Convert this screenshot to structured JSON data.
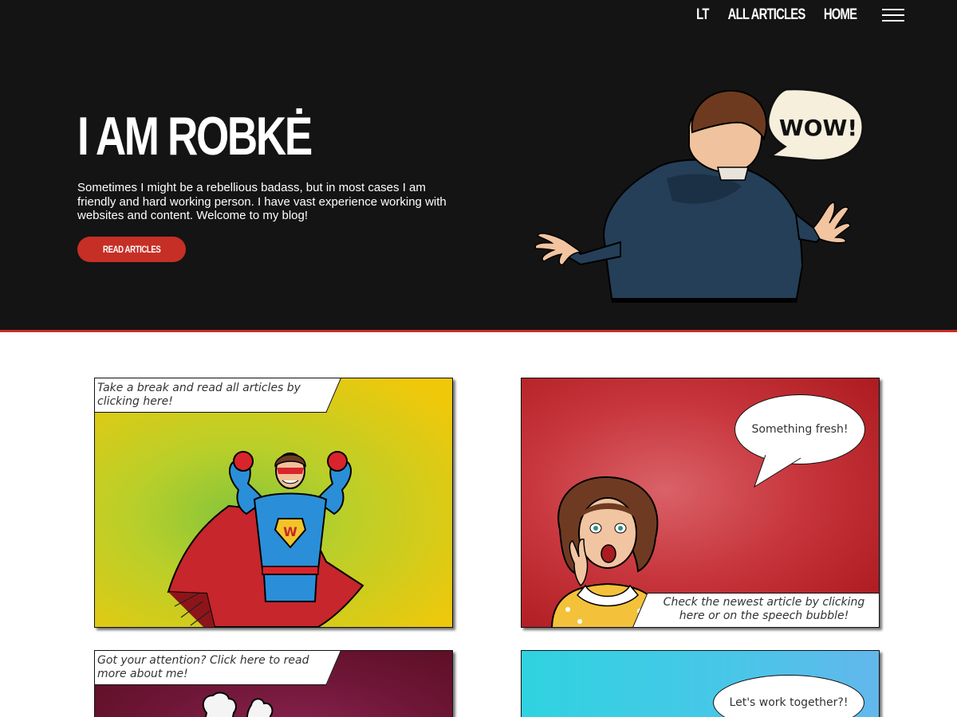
{
  "nav": {
    "lang": "LT",
    "all_articles": "ALL ARTICLES",
    "home": "HOME"
  },
  "hero": {
    "title": "I AM ROBKĖ",
    "text": "Sometimes I might be a rebellious badass, but in most cases I am friendly and hard working person. I have vast experience working with websites and content. Welcome to my blog!",
    "button": "READ ARTICLES",
    "bubble": "WOW!"
  },
  "panels": [
    {
      "caption": "Take a break and read all articles by clicking here!",
      "illustration": "superhero"
    },
    {
      "bubble": "Something fresh!",
      "caption": "Check the newest article by clicking here or on the speech bubble!",
      "illustration": "surprised-woman"
    },
    {
      "caption": "Got your attention? Click here to read more about me!",
      "illustration": "gloved-hands"
    },
    {
      "bubble": "Let's work together?!",
      "illustration": "blue-panel"
    }
  ],
  "colors": {
    "hero_bg": "#141414",
    "accent": "#c62f25",
    "panel1_bg": "#f0c80a",
    "panel2_bg": "#c7363c",
    "panel3_bg": "#6f1637",
    "panel4_bg": "#2fd3e0"
  }
}
